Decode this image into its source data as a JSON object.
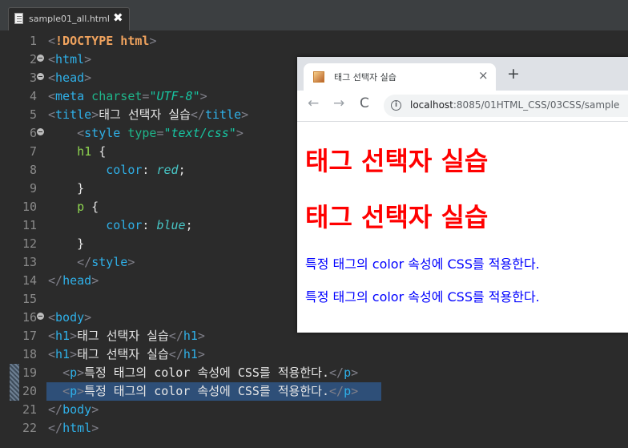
{
  "editor_tab": {
    "file_name": "sample01_all.html",
    "close_glyph": "✖"
  },
  "lines": {
    "l1": {
      "num": "1",
      "open": "<",
      "doctype": "!DOCTYPE",
      "doc_arg": " html",
      "close": ">"
    },
    "l2": {
      "num": "2",
      "open": "<",
      "tag": "html",
      "close": ">"
    },
    "l3": {
      "num": "3",
      "open": "<",
      "tag": "head",
      "close": ">"
    },
    "l4": {
      "num": "4",
      "open": "<",
      "tag": "meta",
      "attr": " charset",
      "eq": "=",
      "val": "\"UTF-8\"",
      "close": ">"
    },
    "l5": {
      "num": "5",
      "open": "<",
      "tag": "title",
      "close": ">",
      "text": "태그 선택자 실습",
      "open2": "</",
      "tag2": "title",
      "close2": ">"
    },
    "l6": {
      "num": "6",
      "indent": "    ",
      "open": "<",
      "tag": "style",
      "attr": " type",
      "eq": "=",
      "val": "\"text/css\"",
      "close": ">"
    },
    "l7": {
      "num": "7",
      "indent": "    ",
      "selector": "h1",
      "brace": " {"
    },
    "l8": {
      "num": "8",
      "indent": "        ",
      "prop": "color",
      "colon": ": ",
      "value": "red",
      "semi": ";"
    },
    "l9": {
      "num": "9",
      "indent": "    ",
      "brace": "}"
    },
    "l10": {
      "num": "10",
      "indent": "    ",
      "selector": "p",
      "brace": " {"
    },
    "l11": {
      "num": "11",
      "indent": "        ",
      "prop": "color",
      "colon": ": ",
      "value": "blue",
      "semi": ";"
    },
    "l12": {
      "num": "12",
      "indent": "    ",
      "brace": "}"
    },
    "l13": {
      "num": "13",
      "indent": "    ",
      "open": "</",
      "tag": "style",
      "close": ">"
    },
    "l14": {
      "num": "14",
      "open": "</",
      "tag": "head",
      "close": ">"
    },
    "l15": {
      "num": "15"
    },
    "l16": {
      "num": "16",
      "open": "<",
      "tag": "body",
      "close": ">"
    },
    "l17": {
      "num": "17",
      "open": "<",
      "tag": "h1",
      "close": ">",
      "text": "태그 선택자 실습",
      "open2": "</",
      "tag2": "h1",
      "close2": ">"
    },
    "l18": {
      "num": "18",
      "open": "<",
      "tag": "h1",
      "close": ">",
      "text": "태그 선택자 실습",
      "open2": "</",
      "tag2": "h1",
      "close2": ">"
    },
    "l19": {
      "num": "19",
      "indent": "  ",
      "open": "<",
      "tag": "p",
      "close": ">",
      "text": "특정 태그의 color 속성에 CSS를 적용한다.",
      "open2": "</",
      "tag2": "p",
      "close2": ">"
    },
    "l20": {
      "num": "20",
      "indent": "  ",
      "open": "<",
      "tag": "p",
      "close": ">",
      "text": "특정 태그의 color 속성에 CSS를 적용한다.",
      "open2": "</",
      "tag2": "p",
      "close2": ">"
    },
    "l21": {
      "num": "21",
      "open": "</",
      "tag": "body",
      "close": ">"
    },
    "l22": {
      "num": "22",
      "open": "</",
      "tag": "html",
      "close": ">"
    }
  },
  "browser": {
    "tab_title": "태그 선택자 실습",
    "tab_close": "×",
    "new_tab": "+",
    "back": "←",
    "forward": "→",
    "reload": "C",
    "info": "i",
    "url_host": "localhost",
    "url_rest": ":8085/01HTML_CSS/03CSS/sample",
    "headings": [
      "태그 선택자 실습",
      "태그 선택자 실습"
    ],
    "paragraphs": [
      "특정 태그의 color 속성에 CSS를 적용한다.",
      "특정 태그의 color 속성에 CSS를 적용한다."
    ]
  },
  "colors": {
    "editor_bg": "#2b2b2b",
    "tag": "#2fb0e8",
    "selection": "#2e4f78",
    "h1_color": "#ff0000",
    "p_color": "#0000ff"
  }
}
